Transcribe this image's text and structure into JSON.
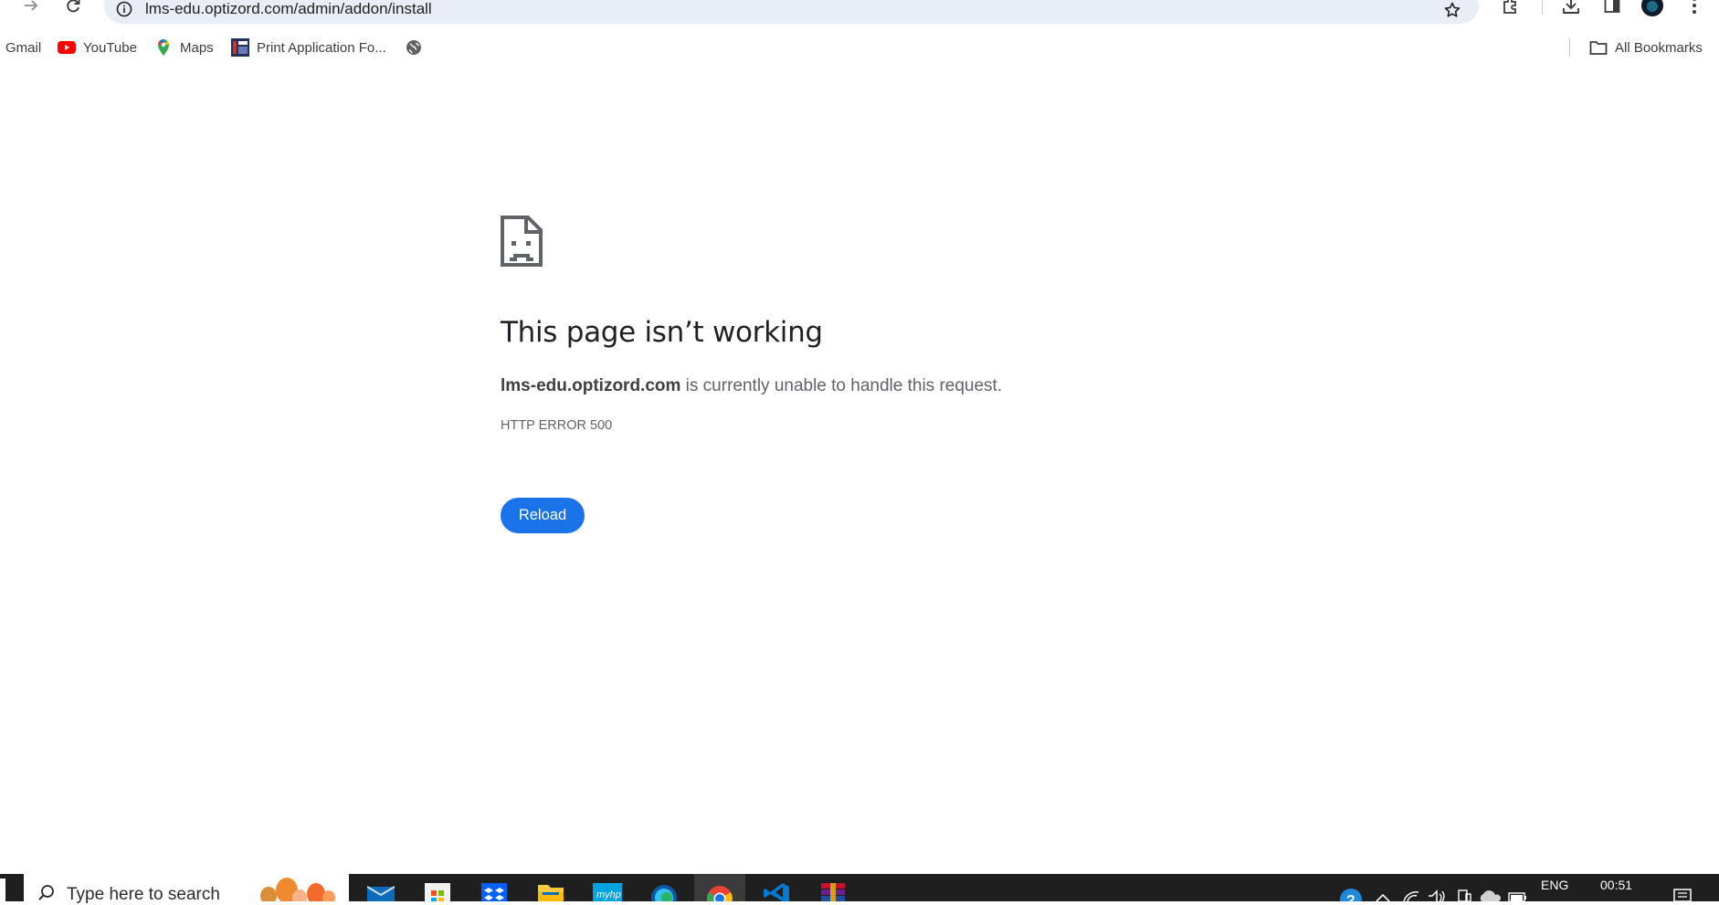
{
  "browser": {
    "url": "lms-edu.optizord.com/admin/addon/install",
    "icons": {
      "forward": "forward-arrow-icon",
      "reload": "reload-icon",
      "info": "site-info-icon",
      "bookmark_star": "bookmark-star-icon",
      "extensions": "extensions-puzzle-icon",
      "downloads": "download-icon",
      "side_panel": "side-panel-icon",
      "profile": "profile-avatar",
      "menu": "kebab-menu-icon"
    }
  },
  "bookmarks": {
    "items": [
      {
        "label": "Gmail",
        "icon": "gmail-icon"
      },
      {
        "label": "YouTube",
        "icon": "youtube-icon"
      },
      {
        "label": "Maps",
        "icon": "maps-pin-icon"
      },
      {
        "label": "Print Application Fo...",
        "icon": "app-favicon"
      },
      {
        "label": "",
        "icon": "globe-icon"
      }
    ],
    "all_bookmarks": "All Bookmarks"
  },
  "error_page": {
    "title": "This page isn’t working",
    "host": "lms-edu.optizord.com",
    "message_rest": " is currently unable to handle this request.",
    "code": "HTTP ERROR 500",
    "reload_label": "Reload"
  },
  "taskbar": {
    "search_placeholder": "Type here to search",
    "apps": [
      "mail-icon",
      "store-icon",
      "dropbox-icon",
      "file-explorer-icon",
      "myhp-icon",
      "edge-icon",
      "chrome-icon",
      "vscode-icon",
      "winrar-icon"
    ],
    "active_app": "chrome-icon",
    "language": "ENG",
    "time": "00:51",
    "colors": {
      "taskbar": "#1f1f1f",
      "accent": "#1a73e8"
    }
  }
}
